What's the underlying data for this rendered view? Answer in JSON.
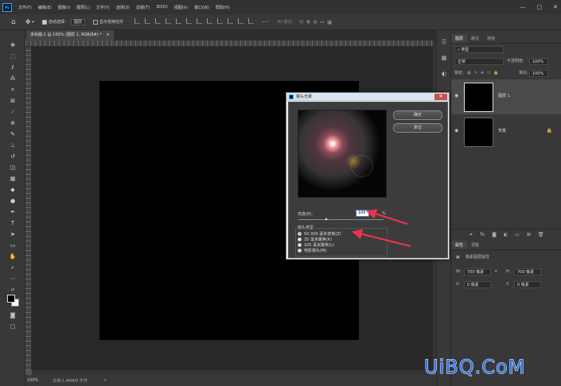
{
  "menubar": {
    "logo": "Ps",
    "items": [
      "文件(F)",
      "编辑(E)",
      "图像(I)",
      "图层(L)",
      "文字(Y)",
      "选择(S)",
      "滤镜(T)",
      "3D(D)",
      "视图(V)",
      "窗口(W)",
      "帮助(H)"
    ],
    "window_buttons": [
      "—",
      "□",
      "✕"
    ]
  },
  "options": {
    "auto_select_label": "自动选择：",
    "auto_select_value": "图层",
    "show_transform_label": "显示变换控件",
    "mode_3d_label": "3D 模式："
  },
  "document": {
    "tab_title": "未标题-1 @ 100% (图层 1, RGB/8#) *",
    "tab_close": "×"
  },
  "status": {
    "zoom": "100%",
    "doc_info": "文档:1.46M/0 字节",
    "arrow": ">"
  },
  "panel": {
    "tabs": [
      "图层",
      "路径",
      "通道"
    ],
    "active_tab": 0,
    "filter_value": "类型",
    "blend_mode": "正常",
    "opacity_label": "不透明度:",
    "opacity_value": "100%",
    "lock_label": "锁定:",
    "fill_label": "填充:",
    "fill_value": "100%",
    "layers": [
      {
        "name": "图层 1",
        "selected": true,
        "locked": false
      },
      {
        "name": "背景",
        "selected": false,
        "locked": true
      }
    ],
    "footer_icons": [
      "link-icon",
      "fx-icon",
      "mask-icon",
      "adjustment-icon",
      "group-icon",
      "new-layer-icon",
      "trash-icon"
    ]
  },
  "properties": {
    "tabs": [
      "属性",
      "调整"
    ],
    "title": "像素图层属性",
    "w_label": "W:",
    "w_value": "700 像素",
    "h_label": "H:",
    "h_value": "700 像素",
    "x_label": "X:",
    "x_value": "0 像素",
    "y_label": "Y:",
    "y_value": "0 像素"
  },
  "dialog": {
    "title": "镜头光晕",
    "ok_label": "确定",
    "reset_label": "复位",
    "brightness_label": "亮度(B):",
    "brightness_value": "100",
    "brightness_unit": "%",
    "brightness_level": 0.33,
    "lens_type_label": "镜头类型",
    "lens_options": [
      {
        "label": "50-300 毫米变焦(Z)",
        "selected": true
      },
      {
        "label": "35 毫米聚焦(K)",
        "selected": false
      },
      {
        "label": "105 毫米聚焦(L)",
        "selected": false
      },
      {
        "label": "电影镜头(M)",
        "selected": false
      }
    ],
    "close_label": "✕"
  },
  "colors": {
    "accent": "#31a8ff",
    "arrow": "#e8344e",
    "watermark": "#2c6fe8"
  },
  "watermark": "UiBQ.CoM"
}
